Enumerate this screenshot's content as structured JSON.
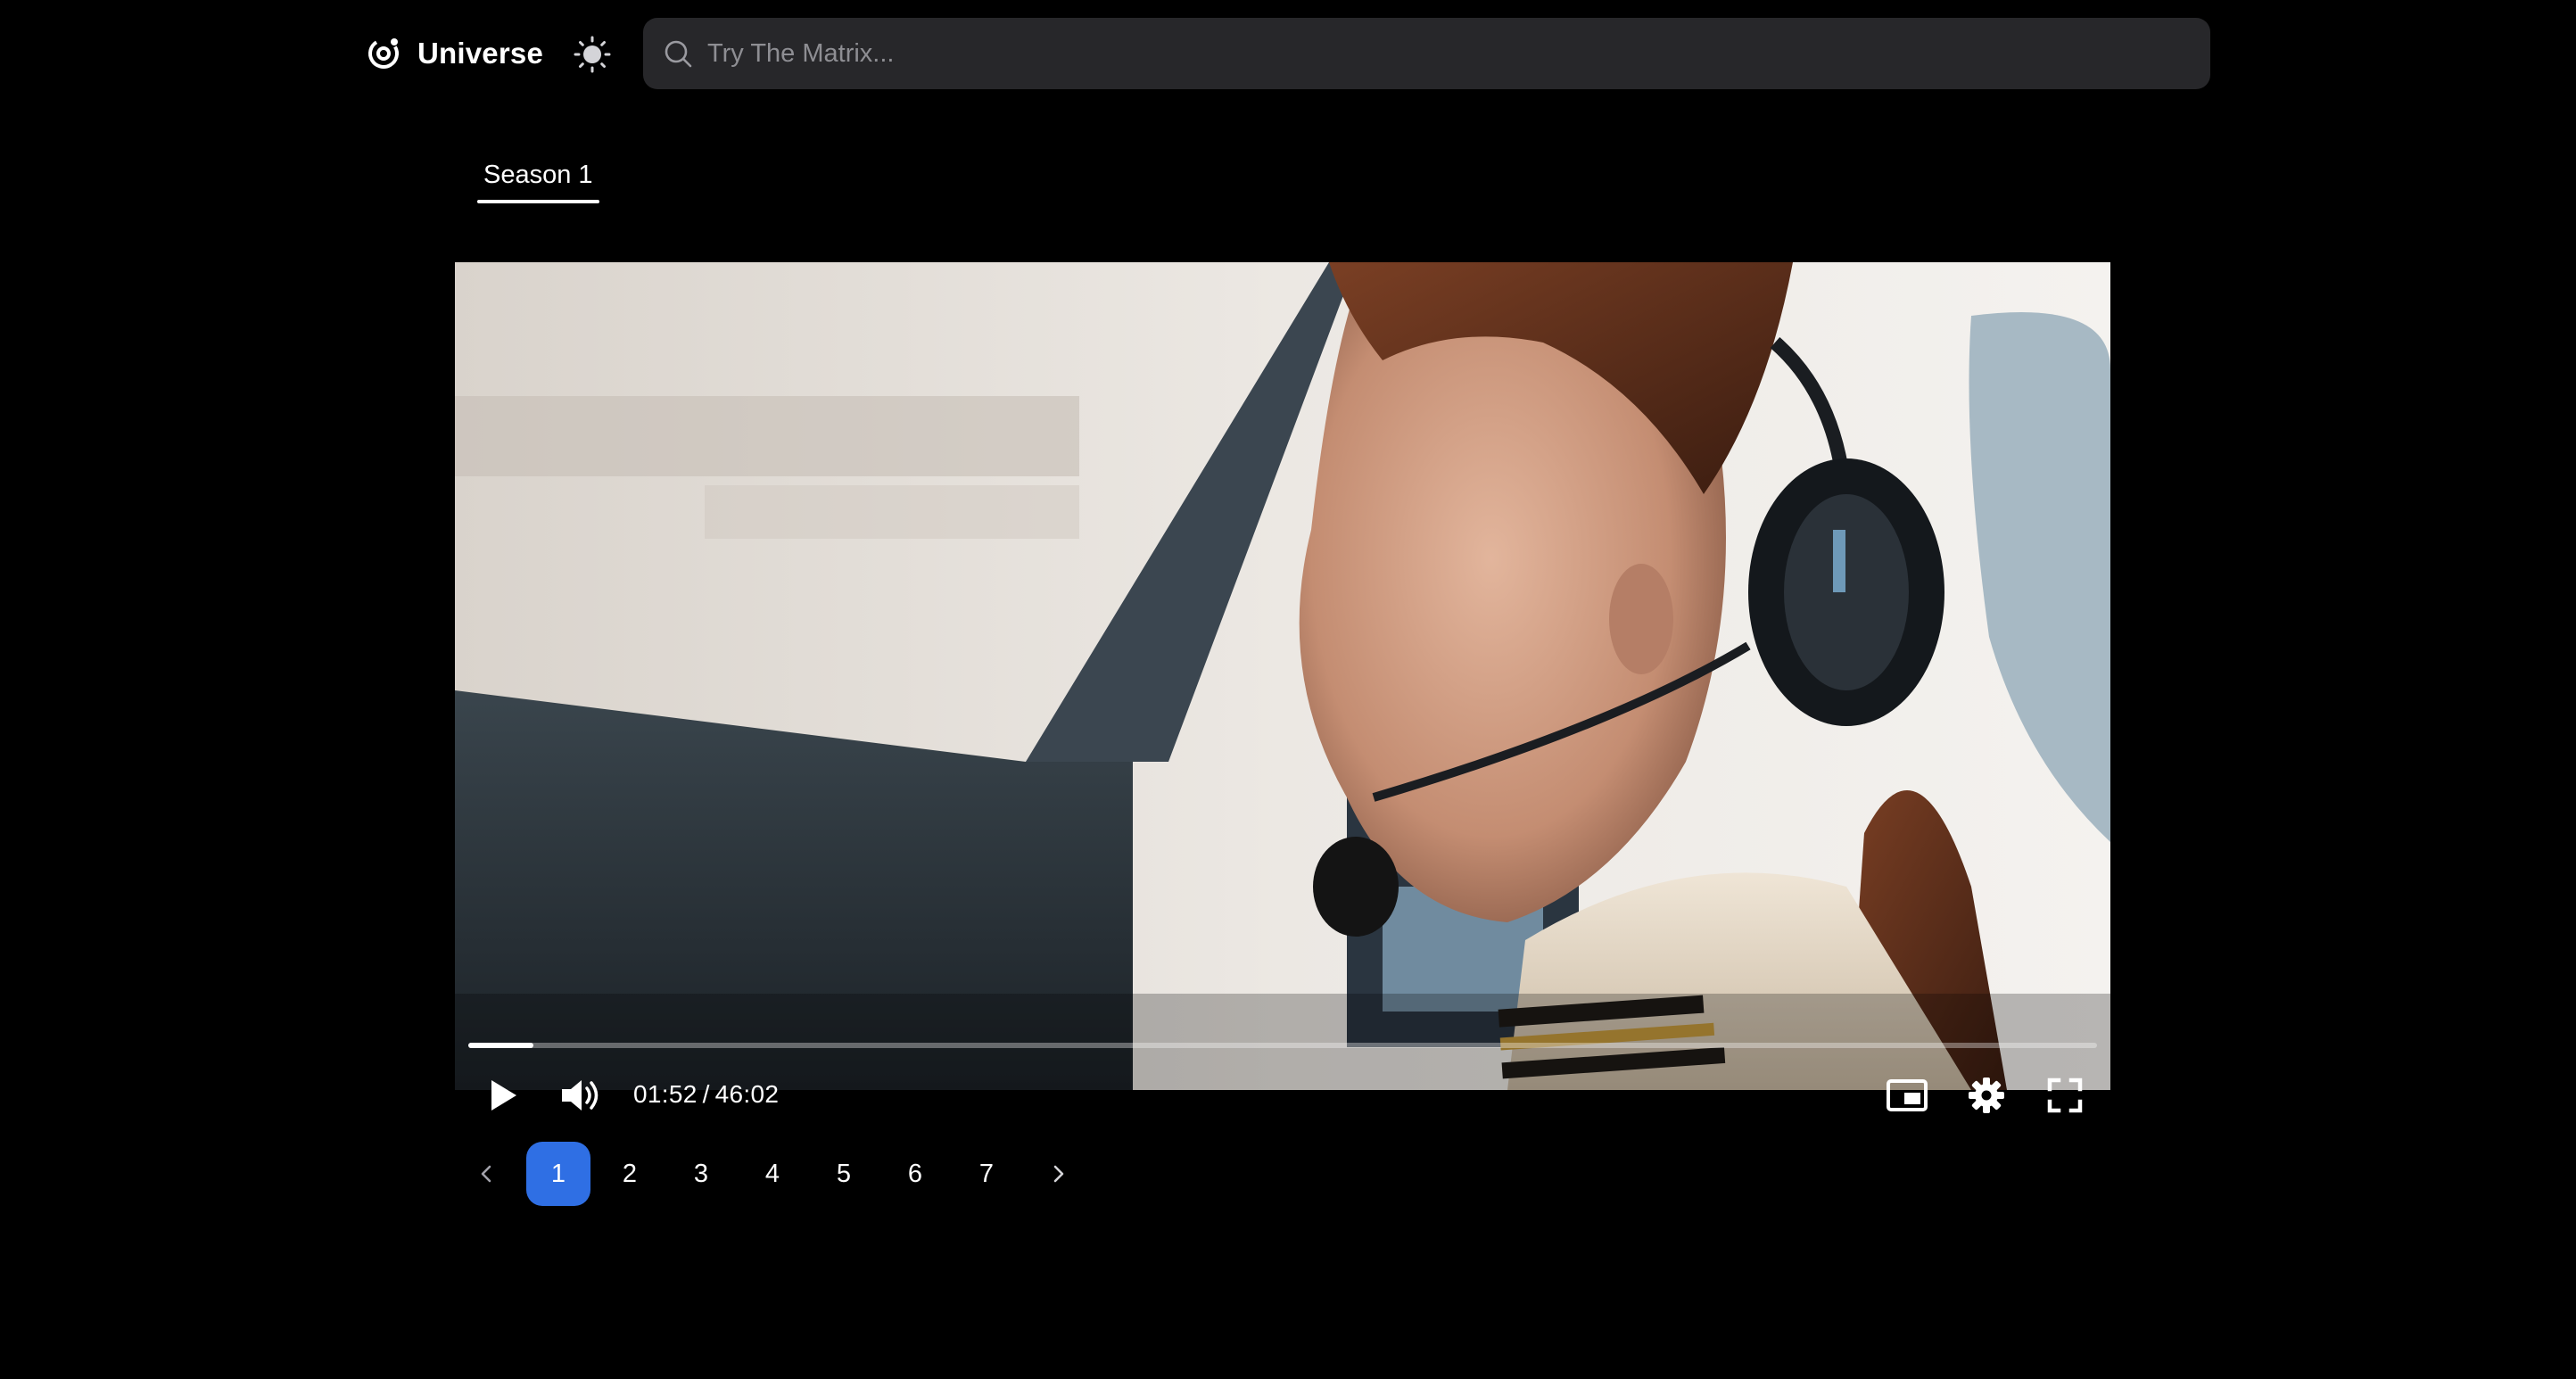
{
  "header": {
    "brand_name": "Universe",
    "logo_icon": "orbit-logo-icon",
    "theme_icon": "sun-icon",
    "search": {
      "placeholder": "Try The Matrix...",
      "value": "",
      "icon": "search-icon"
    }
  },
  "tabs": [
    {
      "label": "Season 1",
      "active": true
    }
  ],
  "player": {
    "current_time": "01:52",
    "separator": "/",
    "duration": "46:02",
    "progress_fraction": 0.04,
    "controls": {
      "play_icon": "play-icon",
      "volume_icon": "volume-icon",
      "pip_icon": "picture-in-picture-icon",
      "settings_icon": "gear-icon",
      "fullscreen_icon": "fullscreen-icon"
    }
  },
  "pagination": {
    "pages": [
      "1",
      "2",
      "3",
      "4",
      "5",
      "6",
      "7"
    ],
    "active_page": "1",
    "prev_icon": "chevron-left-icon",
    "next_icon": "chevron-right-icon"
  },
  "colors": {
    "background": "#000000",
    "search_bg": "#27272a",
    "accent": "#2f6fe4"
  }
}
